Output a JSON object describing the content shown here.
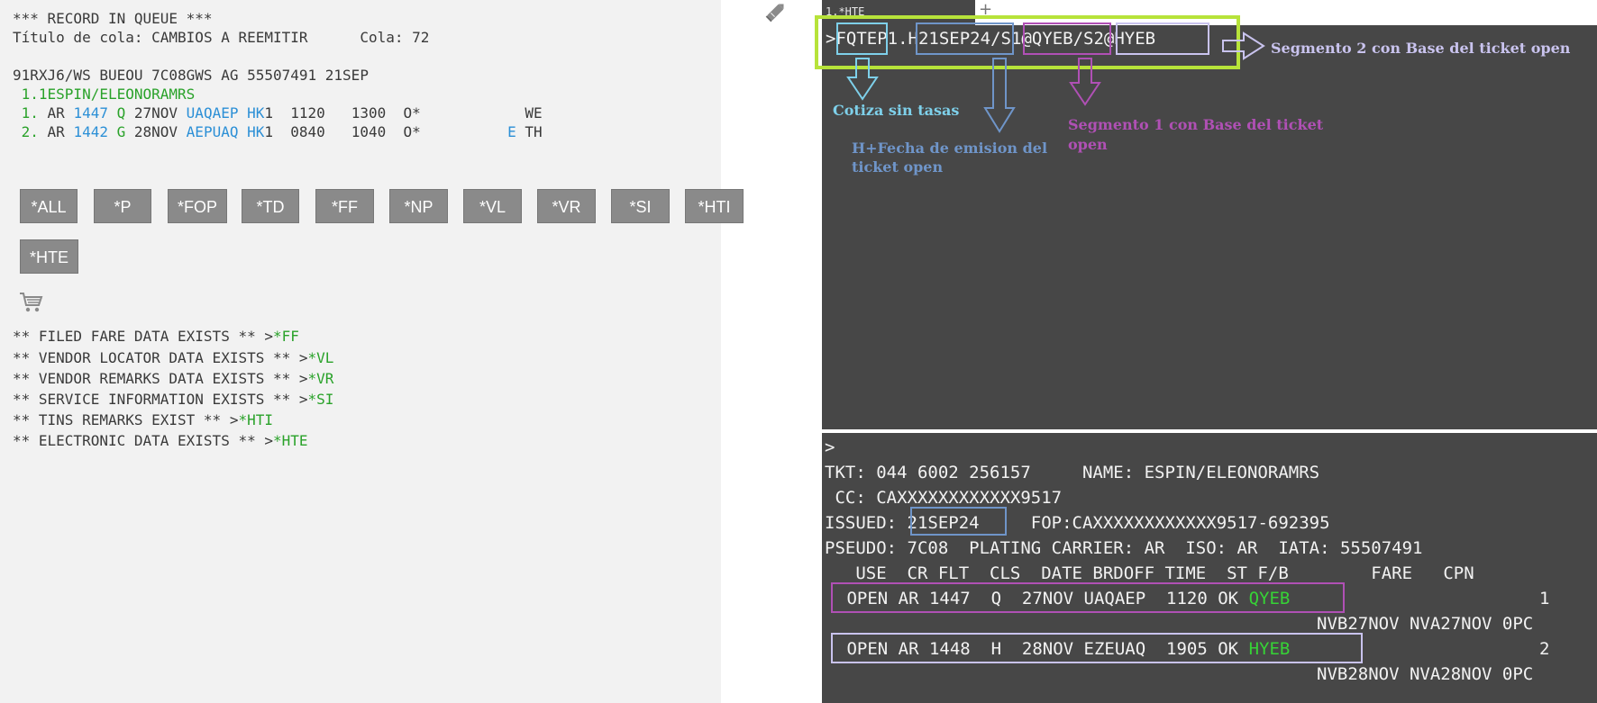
{
  "queue": {
    "header": "*** RECORD IN QUEUE ***",
    "title_label": "Título de cola:",
    "title_value": "CAMBIOS A REEMITIR",
    "count_label": "Cola:",
    "count_value": "72"
  },
  "pnr": {
    "header_line": "91RXJ6/WS BUEOU 7C08GWS AG 55507491 21SEP",
    "passenger": " 1.1ESPIN/ELEONORAMRS",
    "segments": [
      {
        "num": " 1.",
        "airline": " AR ",
        "flight": "1447",
        "cls": " Q",
        "date": " 27NOV ",
        "route": "UAQAEP",
        "sp": " ",
        "status": "HK",
        "pax": "1  1120   1300  O*          ",
        "e": " ",
        "rest": " WE"
      },
      {
        "num": " 2.",
        "airline": " AR ",
        "flight": "1442",
        "cls": " G",
        "date": " 28NOV ",
        "route": "AEPUAQ",
        "sp": " ",
        "status": "HK",
        "pax": "1  0840   1040  O*          ",
        "e": "E",
        "rest": " TH"
      }
    ]
  },
  "buttons": [
    "*ALL",
    "*P",
    "*FOP",
    "*TD",
    "*FF",
    "*NP",
    "*VL",
    "*VR",
    "*SI",
    "*HTI",
    "*HTE"
  ],
  "exists": [
    {
      "text": "** FILED FARE DATA EXISTS ** >",
      "link": "*FF"
    },
    {
      "text": "** VENDOR LOCATOR DATA EXISTS ** >",
      "link": "*VL"
    },
    {
      "text": "** VENDOR REMARKS DATA EXISTS ** >",
      "link": "*VR"
    },
    {
      "text": "** SERVICE INFORMATION EXISTS ** >",
      "link": "*SI"
    },
    {
      "text": "** TINS REMARKS EXIST ** >",
      "link": "*HTI"
    },
    {
      "text": "** ELECTRONIC DATA EXISTS ** >",
      "link": "*HTE"
    }
  ],
  "terminal": {
    "tab_label": "1.*HTE",
    "command": {
      "prompt": ">",
      "p1": "FQTE",
      "p2": "P1.",
      "p3": "H21SEP24",
      "sl1": "/",
      "p4": "S1@QYEB",
      "sl2": "/",
      "p5": "S2@HYEB"
    },
    "lower_prompt": ">",
    "ticket": {
      "line1": "TKT: 044 6002 256157     NAME: ESPIN/ELEONORAMRS",
      "line2": " CC: CAXXXXXXXXXXXX9517",
      "issued_label": "ISSUED: ",
      "issued_value": "21SEP24",
      "fop": "FOP:CAXXXXXXXXXXXX9517-692395",
      "line4": "PSEUDO: 7C08  PLATING CARRIER: AR  ISO: AR  IATA: 55507491",
      "header": "   USE  CR FLT  CLS  DATE BRDOFF TIME  ST F/B        FARE   CPN",
      "coupons": [
        {
          "text": " OPEN AR 1447  Q  27NOV UAQAEP  1120 OK ",
          "fb": "QYEB",
          "cpn": "1",
          "sub": "NVB27NOV NVA27NOV 0PC"
        },
        {
          "text": " OPEN AR 1448  H  28NOV EZEUAQ  1905 OK ",
          "fb": "HYEB",
          "cpn": "2",
          "sub": "NVB28NOV NVA28NOV 0PC"
        }
      ]
    }
  },
  "annotations": {
    "cotiza": "Cotiza sin tasas",
    "fecha_1": "H+Fecha de emision del",
    "fecha_2": "ticket open",
    "seg1_1": "Segmento 1 con Base del ticket",
    "seg1_2": "open",
    "seg2": "Segmento 2 con Base del ticket open"
  },
  "colors": {
    "left_bg": "#f2f2f2",
    "terminal_bg": "#474747",
    "green": "#2aa22a",
    "blue": "#2b8fd6",
    "lime_box": "#b7e33a",
    "cyan": "#7ed0ea",
    "steel": "#6f95c9",
    "magenta": "#b050b5",
    "lavender": "#c9c3ee"
  }
}
